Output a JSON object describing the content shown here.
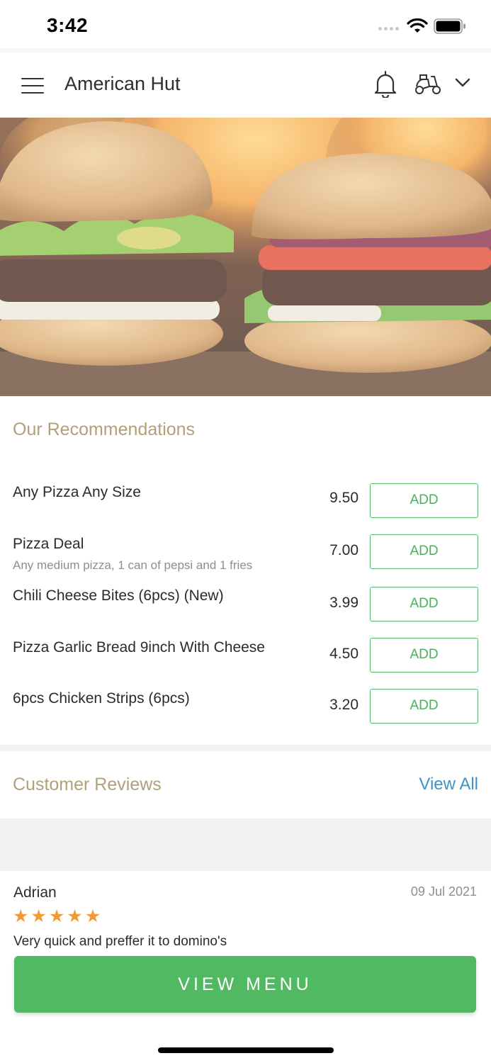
{
  "status_bar": {
    "time": "3:42"
  },
  "header": {
    "title": "American Hut"
  },
  "recommendations": {
    "title": "Our Recommendations",
    "items": [
      {
        "name": "Any Pizza Any Size",
        "description": "",
        "price": "9.50",
        "button": "ADD"
      },
      {
        "name": "Pizza Deal",
        "description": "Any medium pizza, 1 can of pepsi and 1 fries",
        "price": "7.00",
        "button": "ADD"
      },
      {
        "name": "Chili Cheese Bites (6pcs) (New)",
        "description": "",
        "price": "3.99",
        "button": "ADD"
      },
      {
        "name": "Pizza Garlic Bread 9inch With Cheese",
        "description": "",
        "price": "4.50",
        "button": "ADD"
      },
      {
        "name": "6pcs Chicken Strips (6pcs)",
        "description": "",
        "price": "3.20",
        "button": "ADD"
      }
    ]
  },
  "reviews": {
    "title": "Customer Reviews",
    "view_all": "View All",
    "items": [
      {
        "name": "Adrian",
        "date": "09 Jul 2021",
        "rating": 5,
        "text": "Very quick and preffer it to domino's"
      }
    ]
  },
  "cta": {
    "label": "VIEW MENU"
  },
  "colors": {
    "accent_green": "#52b963",
    "section_title": "#b3a07a",
    "link_blue": "#3a96c7",
    "star": "#f19a36"
  }
}
